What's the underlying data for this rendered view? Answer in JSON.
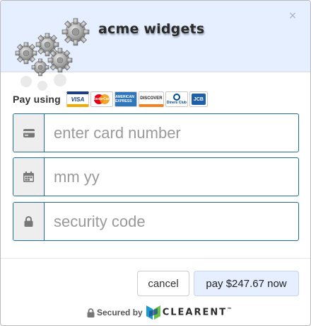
{
  "header": {
    "brand_name": "acme widgets",
    "close_label": "×"
  },
  "pay_using": {
    "label": "Pay using",
    "cards": [
      {
        "name": "visa",
        "text": "VISA"
      },
      {
        "name": "mastercard",
        "text": "MasterCard"
      },
      {
        "name": "amex",
        "text": "AMERICAN EXPRESS"
      },
      {
        "name": "discover",
        "text": "DISCOVER"
      },
      {
        "name": "diners",
        "text": "Diners Club"
      },
      {
        "name": "jcb",
        "text": "JCB"
      }
    ]
  },
  "form": {
    "card_number": {
      "value": "",
      "placeholder": "enter card number",
      "icon": "credit-card-icon"
    },
    "expiry": {
      "value": "",
      "placeholder": "mm yy",
      "icon": "calendar-icon"
    },
    "security_code": {
      "value": "",
      "placeholder": "security code",
      "icon": "lock-icon"
    }
  },
  "actions": {
    "cancel_label": "cancel",
    "pay_label": "pay $247.67 now"
  },
  "footer": {
    "secured_by": "Secured by",
    "provider": "CLEARENT",
    "trademark": "™"
  },
  "colors": {
    "header_bg": "#e5efff",
    "field_border": "#1d6e9b",
    "addon_bg": "#eeeeee",
    "pay_button_bg": "#e5efff"
  }
}
